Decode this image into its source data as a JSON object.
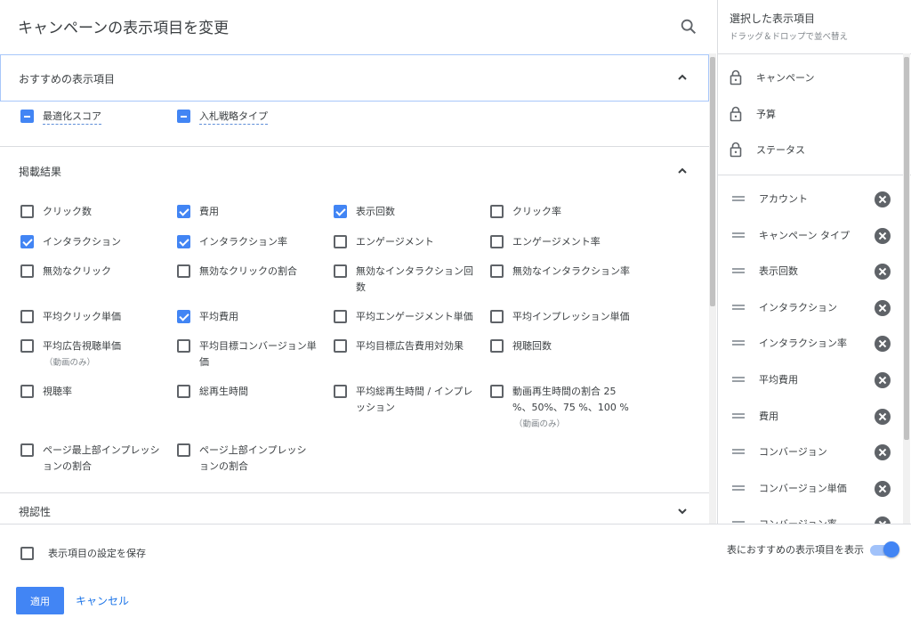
{
  "dialog": {
    "title": "キャンペーンの表示項目を変更"
  },
  "recommended": {
    "title": "おすすめの表示項目",
    "items": [
      "最適化スコア",
      "入札戦略タイプ"
    ]
  },
  "results": {
    "title": "掲載結果",
    "items": [
      {
        "label": "クリック数",
        "checked": false
      },
      {
        "label": "費用",
        "checked": true
      },
      {
        "label": "表示回数",
        "checked": true
      },
      {
        "label": "クリック率",
        "checked": false
      },
      {
        "label": "インタラクション",
        "checked": true
      },
      {
        "label": "インタラクション率",
        "checked": true
      },
      {
        "label": "エンゲージメント",
        "checked": false
      },
      {
        "label": "エンゲージメント率",
        "checked": false
      },
      {
        "label": "無効なクリック",
        "checked": false
      },
      {
        "label": "無効なクリックの割合",
        "checked": false
      },
      {
        "label": "無効なインタラクション回",
        "label2": "数",
        "checked": false
      },
      {
        "label": "無効なインタラクション率",
        "checked": false
      },
      {
        "label": "平均クリック単価",
        "checked": false
      },
      {
        "label": "平均費用",
        "checked": true
      },
      {
        "label": "平均エンゲージメント単価",
        "checked": false
      },
      {
        "label": "平均インプレッション単価",
        "checked": false
      },
      {
        "label": "平均広告視聴単価",
        "note": "（動画のみ）",
        "checked": false
      },
      {
        "label": "平均目標コンバージョン単",
        "label2": "価",
        "checked": false
      },
      {
        "label": "平均目標広告費用対効果",
        "checked": false
      },
      {
        "label": "視聴回数",
        "checked": false
      },
      {
        "label": "視聴率",
        "checked": false
      },
      {
        "label": "総再生時間",
        "checked": false
      },
      {
        "label": "平均総再生時間 / インプレ",
        "label2": "ッション",
        "checked": false
      },
      {
        "label": "動画再生時間の割合 25",
        "label2": "%、50%、75 %、100 %",
        "note": "（動画のみ）",
        "checked": false
      },
      {
        "label": "ページ最上部インプレッシ",
        "label2": "ョンの割合",
        "checked": false
      },
      {
        "label": "ページ上部インプレッシ",
        "label2": "ョンの割合",
        "checked": false
      }
    ]
  },
  "viewability": {
    "title": "視認性"
  },
  "footer": {
    "save_label": "表示項目の設定を保存",
    "toggle_label": "表におすすめの表示項目を表示",
    "apply_label": "適用",
    "cancel_label": "キャンセル"
  },
  "selected": {
    "title": "選択した表示項目",
    "subtitle": "ドラッグ＆ドロップで並べ替え",
    "locked": [
      "キャンペーン",
      "予算",
      "ステータス"
    ],
    "items": [
      "アカウント",
      "キャンペーン タイプ",
      "表示回数",
      "インタラクション",
      "インタラクション率",
      "平均費用",
      "費用",
      "コンバージョン",
      "コンバージョン単価",
      "コンバージョン率"
    ]
  },
  "colors": {
    "accent": "#4285f4",
    "link": "#1a73e8",
    "text": "#3c4043"
  }
}
